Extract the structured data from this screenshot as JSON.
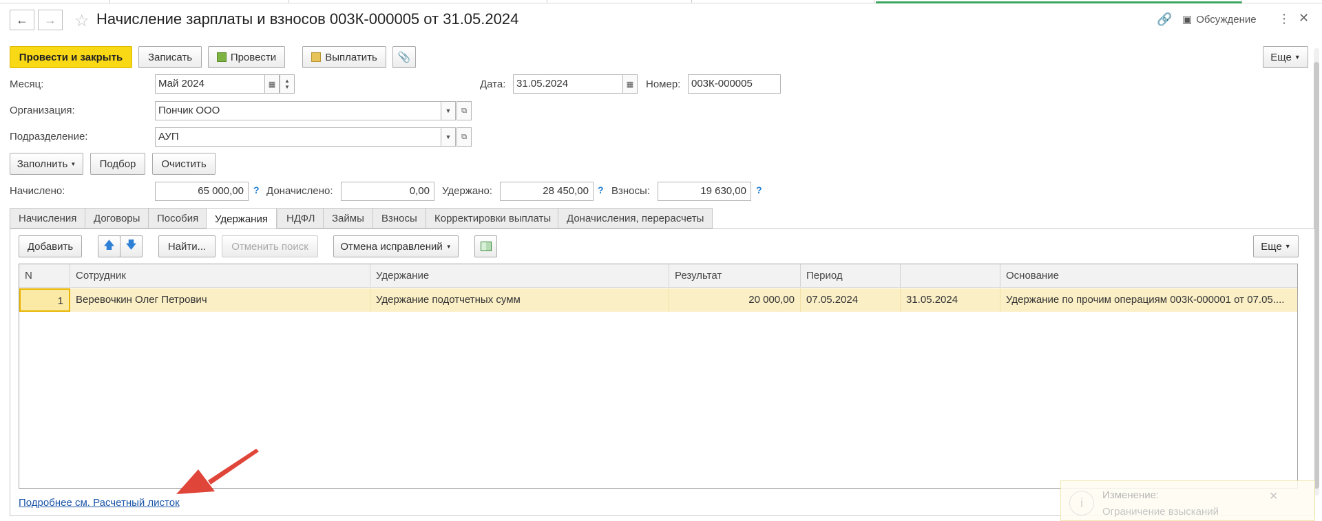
{
  "window": {
    "title": "Начисление зарплаты и взносов 003К-000005 от 31.05.2024",
    "discussion_label": "Обсуждение"
  },
  "toolbar": {
    "post_close": "Провести и закрыть",
    "save": "Записать",
    "post": "Провести",
    "pay": "Выплатить",
    "more": "Еще"
  },
  "form": {
    "month_label": "Месяц:",
    "month_value": "Май 2024",
    "date_label": "Дата:",
    "date_value": "31.05.2024",
    "number_label": "Номер:",
    "number_value": "003К-000005",
    "org_label": "Организация:",
    "org_value": "Пончик ООО",
    "dept_label": "Подразделение:",
    "dept_value": "АУП"
  },
  "actions": {
    "fill": "Заполнить",
    "pick": "Подбор",
    "clear": "Очистить"
  },
  "totals": {
    "accrued_label": "Начислено:",
    "accrued_value": "65 000,00",
    "extra_label": "Доначислено:",
    "extra_value": "0,00",
    "withheld_label": "Удержано:",
    "withheld_value": "28 450,00",
    "contrib_label": "Взносы:",
    "contrib_value": "19 630,00",
    "help": "?"
  },
  "tabs": [
    {
      "label": "Начисления"
    },
    {
      "label": "Договоры"
    },
    {
      "label": "Пособия"
    },
    {
      "label": "Удержания"
    },
    {
      "label": "НДФЛ"
    },
    {
      "label": "Займы"
    },
    {
      "label": "Взносы"
    },
    {
      "label": "Корректировки выплаты"
    },
    {
      "label": "Доначисления, перерасчеты"
    }
  ],
  "table_toolbar": {
    "add": "Добавить",
    "find": "Найти...",
    "cancel_search": "Отменить поиск",
    "cancel_fixes": "Отмена исправлений",
    "more": "Еще"
  },
  "table": {
    "columns": [
      "N",
      "Сотрудник",
      "Удержание",
      "Результат",
      "Период",
      "",
      "Основание"
    ],
    "rows": [
      [
        "1",
        "Веревочкин Олег Петрович",
        "Удержание подотчетных сумм",
        "20 000,00",
        "07.05.2024",
        "31.05.2024",
        "Удержание по прочим операциям 003К-000001 от 07.05...."
      ]
    ]
  },
  "footer": {
    "link": "Подробнее см. Расчетный листок"
  },
  "notification": {
    "title": "Изменение:",
    "text": "Ограничение взысканий"
  },
  "colors": {
    "primary_button": "#f9d816",
    "selected_row": "#fbefc6",
    "link": "#1a55a8",
    "arrow": "#e0453a",
    "help": "#1f7ed1"
  }
}
